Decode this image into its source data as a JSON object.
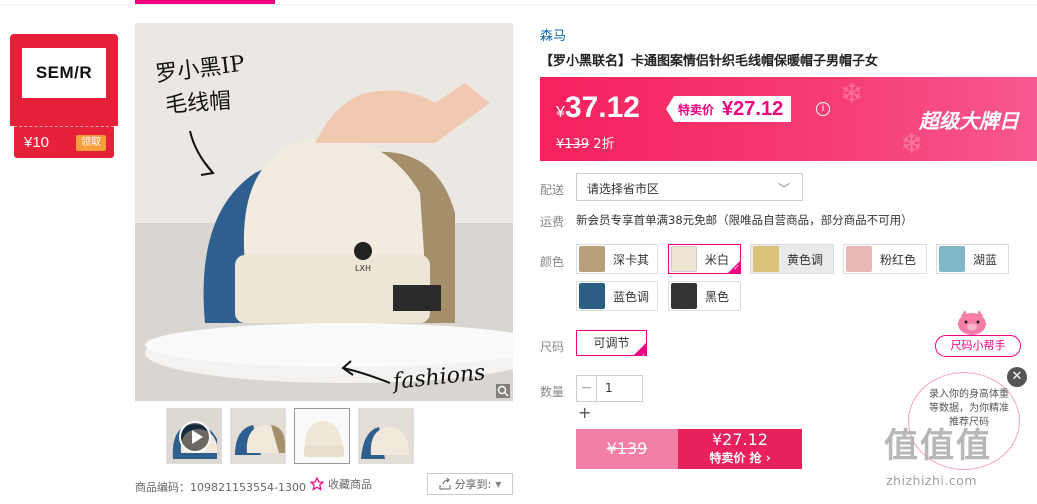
{
  "brand_card": {
    "logo_text": "SEM/R",
    "coupon": "¥10",
    "get_label": "领取"
  },
  "main_image": {
    "hand_text_line1": "罗小黑IP",
    "hand_text_line2": "毛线帽",
    "hand_text_fashion": "fashions"
  },
  "product": {
    "brand": "森马",
    "title": "【罗小黑联名】卡通图案情侣针织毛线帽保暖帽子男帽子女"
  },
  "price": {
    "currency": "¥",
    "main": "37.12",
    "special_label": "特卖价",
    "special_value": "¥27.12",
    "original": "¥139",
    "discount": "2折",
    "promo_banner": "超级大牌日",
    "info_icon": "i"
  },
  "delivery": {
    "label": "配送",
    "placeholder": "请选择省市区"
  },
  "shipping": {
    "label": "运费",
    "text": "新会员专享首单满38元免邮（限唯品自营商品，部分商品不可用）"
  },
  "colors": {
    "label": "颜色",
    "options": [
      "深卡其",
      "米白",
      "黄色调",
      "粉红色",
      "湖蓝",
      "蓝色调",
      "黑色"
    ],
    "swatches": [
      "#b9a07a",
      "#efe6d6",
      "#d9c27a",
      "#e9b7b7",
      "#7fb9c9",
      "#2e5d8a",
      "#333333"
    ]
  },
  "size": {
    "label": "尺码",
    "option": "可调节"
  },
  "quantity": {
    "label": "数量",
    "minus": "−",
    "value": "1",
    "plus": "+"
  },
  "buy": {
    "orig": "¥139",
    "price": "¥27.12",
    "action": "特卖价 抢 ›"
  },
  "meta": {
    "sku": "商品编码：109821153554-1300",
    "favorite": "收藏商品",
    "share": "分享到:"
  },
  "helper": {
    "button": "尺码小帮手",
    "text": "录入你的身高体重等数据，为你精准推荐尺码",
    "close": "✕"
  },
  "watermark": {
    "big": "值值值",
    "small": "zhizhizhi.com"
  },
  "colors_theme": {
    "accent": "#f10180",
    "price_bg": "#f5215d",
    "brand_red": "#e8213b"
  }
}
